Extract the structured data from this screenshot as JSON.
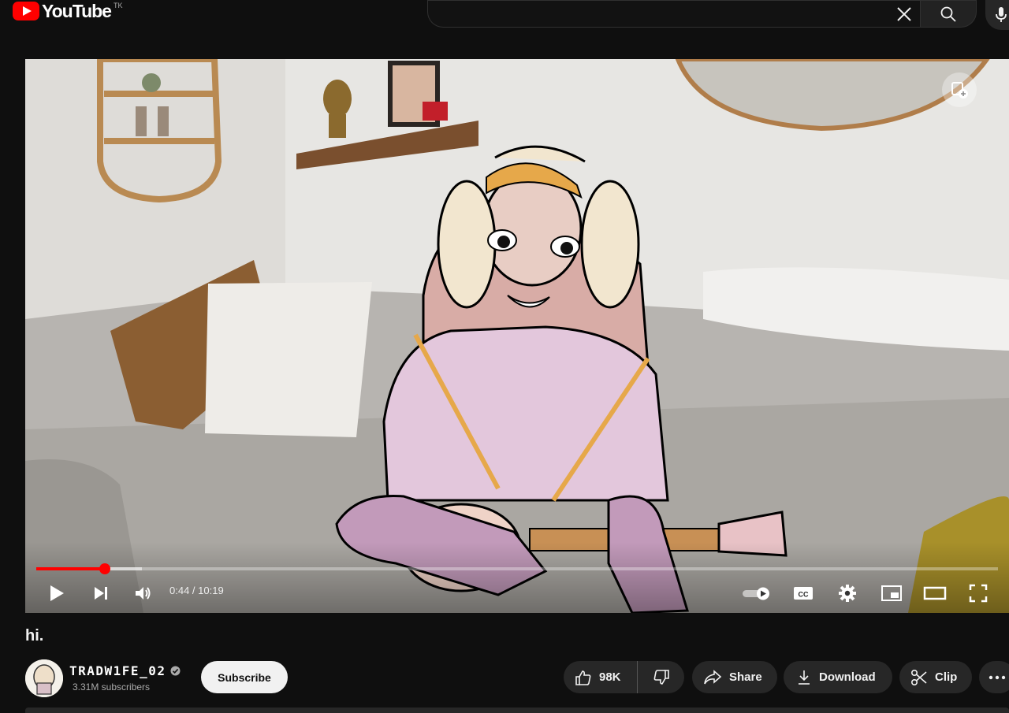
{
  "header": {
    "logo_text": "YouTube",
    "country_code": "TK",
    "search": {
      "value": "",
      "placeholder": ""
    },
    "icons": [
      "youtube-logo-icon",
      "close-icon",
      "search-icon",
      "microphone-icon"
    ]
  },
  "player": {
    "current_time": "0:44",
    "separator": " / ",
    "duration": "10:19",
    "progress_played": 0.071,
    "progress_buffered": 0.11,
    "autoplay_on": true,
    "icons": [
      "play-icon",
      "next-icon",
      "volume-icon",
      "autoplay-toggle-icon",
      "captions-icon",
      "settings-icon",
      "miniplayer-icon",
      "theater-mode-icon",
      "fullscreen-icon",
      "add-to-playlist-icon"
    ],
    "colors": {
      "progress": "#ff0000"
    }
  },
  "video": {
    "title": "hi.",
    "channel_name": "TRADW1FE_02",
    "subscribers": "3.31M subscribers",
    "subscribe_label": "Subscribe",
    "likes": "98K",
    "share_label": "Share",
    "download_label": "Download",
    "clip_label": "Clip"
  }
}
